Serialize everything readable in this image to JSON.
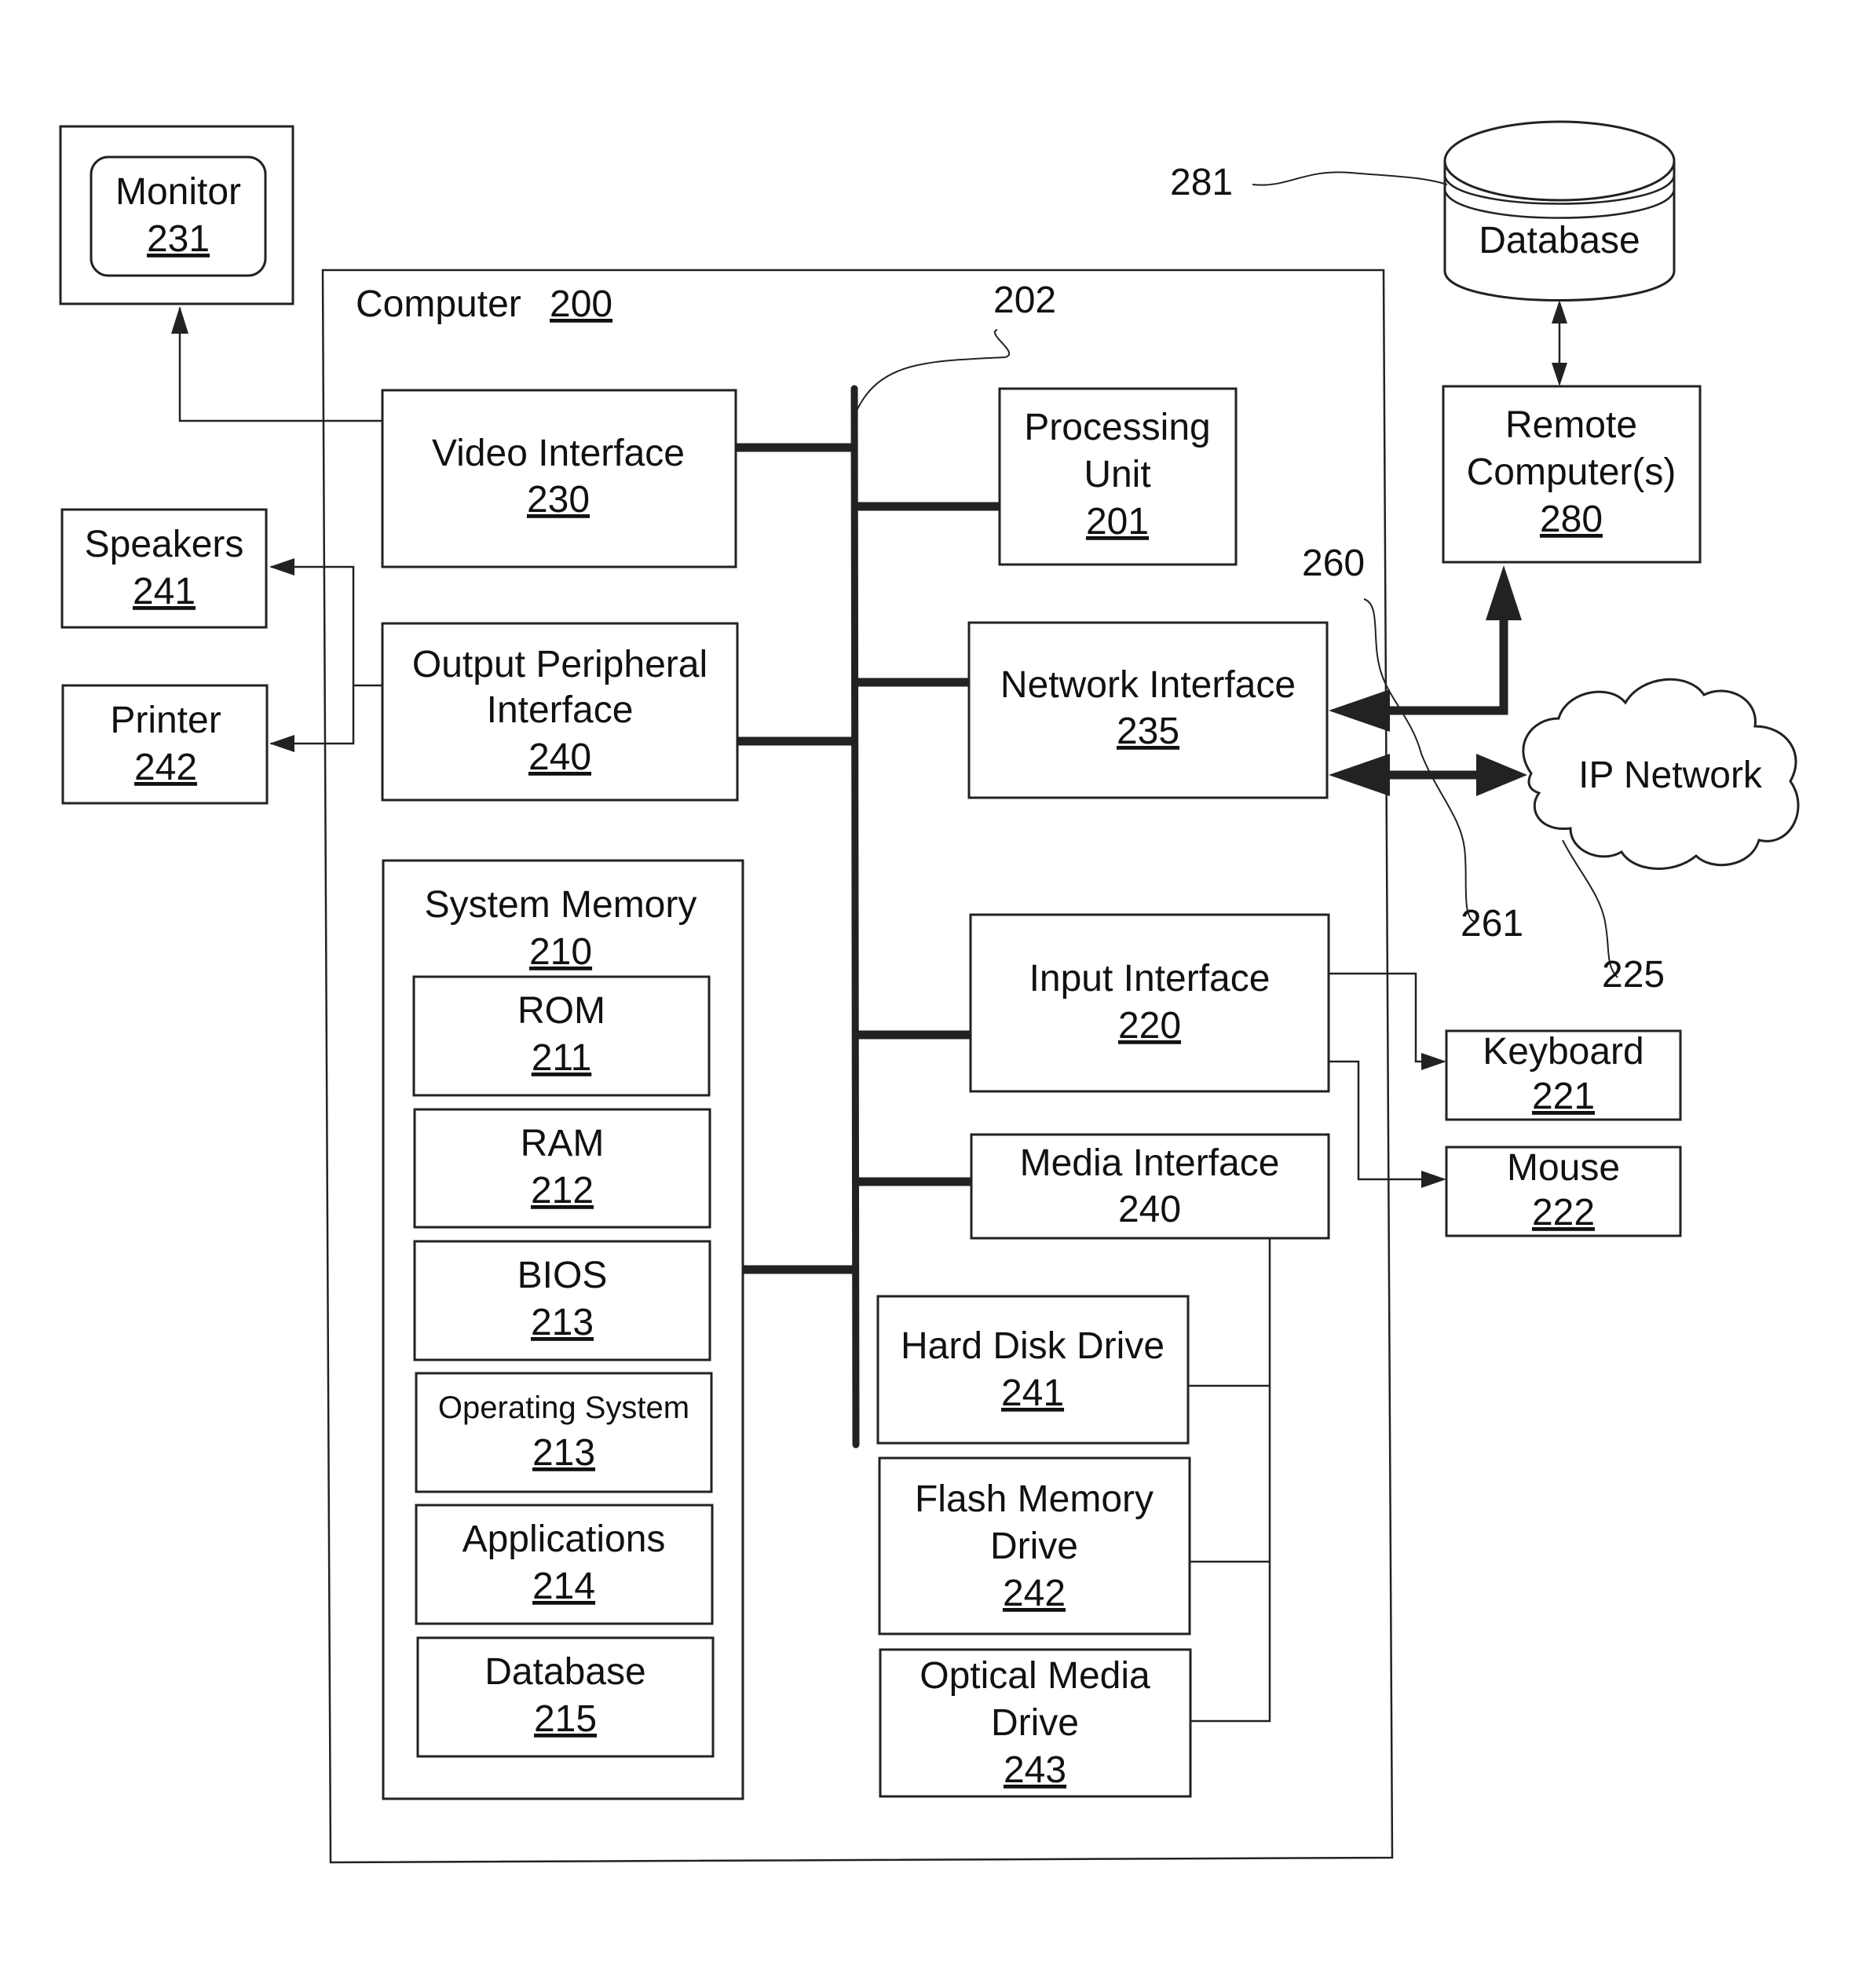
{
  "figure": {
    "computer": {
      "label": "Computer",
      "ref": "200"
    },
    "monitor": {
      "label": "Monitor",
      "ref": "231"
    },
    "speakers": {
      "label": "Speakers",
      "ref": "241"
    },
    "printer": {
      "label": "Printer",
      "ref": "242"
    },
    "video_interface": {
      "label": "Video Interface",
      "ref": "230"
    },
    "output_peripheral_interface": {
      "line1": "Output Peripheral",
      "line2": "Interface",
      "ref": "240"
    },
    "processing_unit": {
      "line1": "Processing",
      "line2": "Unit",
      "ref": "201"
    },
    "network_interface": {
      "label": "Network Interface",
      "ref": "235"
    },
    "input_interface": {
      "label": "Input Interface",
      "ref": "220"
    },
    "media_interface": {
      "label": "Media Interface",
      "ref": "240"
    },
    "system_memory": {
      "label": "System Memory",
      "ref": "210",
      "items": [
        {
          "label": "ROM",
          "ref": "211"
        },
        {
          "label": "RAM",
          "ref": "212"
        },
        {
          "label": "BIOS",
          "ref": "213"
        },
        {
          "label": "Operating System",
          "ref": "213"
        },
        {
          "label": "Applications",
          "ref": "214"
        },
        {
          "label": "Database",
          "ref": "215"
        }
      ]
    },
    "hard_disk_drive": {
      "label": "Hard Disk Drive",
      "ref": "241"
    },
    "flash_memory_drive": {
      "line1": "Flash Memory",
      "line2": "Drive",
      "ref": "242"
    },
    "optical_media_drive": {
      "line1": "Optical Media",
      "line2": "Drive",
      "ref": "243"
    },
    "remote_database": {
      "label": "Database"
    },
    "remote_computers": {
      "line1": "Remote",
      "line2": "Computer(s)",
      "ref": "280"
    },
    "ip_network": {
      "label": "IP Network"
    },
    "keyboard": {
      "label": "Keyboard",
      "ref": "221"
    },
    "mouse": {
      "label": "Mouse",
      "ref": "222"
    },
    "callouts": {
      "bus": "202",
      "database": "281",
      "link_260": "260",
      "link_261": "261",
      "network": "225"
    }
  }
}
